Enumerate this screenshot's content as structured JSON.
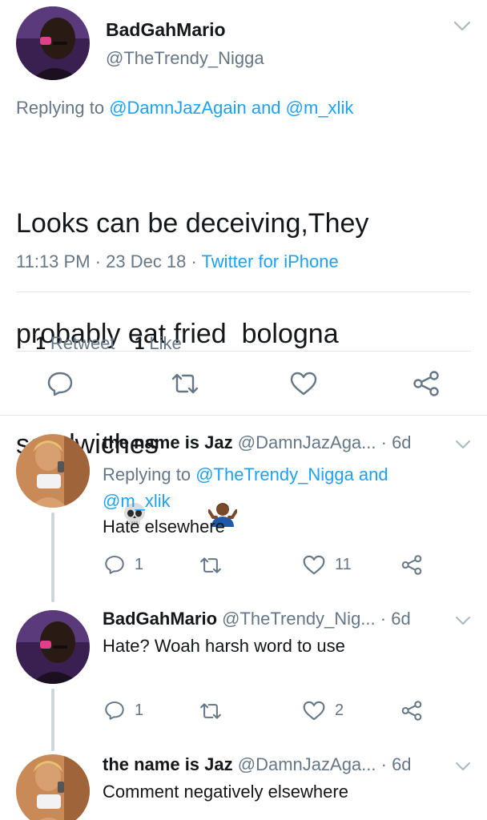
{
  "main_tweet": {
    "display_name": "BadGahMario",
    "handle": "@TheTrendy_Nigga",
    "replying_prefix": "Replying to ",
    "reply_user_1": "@DamnJazAgain",
    "reply_and": " and ",
    "reply_user_2": "@m_xlik",
    "text_line1": "Looks can be deceiving,They",
    "text_line2": "probably eat fried  bologna",
    "text_line3": "sandwiches",
    "time": "11:13 PM",
    "sep1": " · ",
    "date": "23 Dec 18",
    "sep2": " · ",
    "source": "Twitter for iPhone",
    "retweet_count": "1",
    "retweet_label": "Retweet",
    "like_count": "1",
    "like_label": "Like",
    "emojis": [
      "skull-icon",
      "man-shrugging-icon"
    ]
  },
  "replies": [
    {
      "display_name": "the name is Jaz",
      "handle": "@DamnJazAga...",
      "age": "· 6d",
      "replying_prefix": "Replying to ",
      "reply_user_1": "@TheTrendy_Nigga",
      "reply_and": " and",
      "reply_user_2": "@m_xlik",
      "text": "Hate elsewhere",
      "reply_count": "1",
      "retweet_count": "",
      "like_count": "11"
    },
    {
      "display_name": "BadGahMario",
      "handle": "@TheTrendy_Nig...",
      "age": "· 6d",
      "text": "Hate? Woah harsh word to use",
      "reply_count": "1",
      "retweet_count": "",
      "like_count": "2"
    },
    {
      "display_name": "the name is Jaz",
      "handle": "@DamnJazAga...",
      "age": "· 6d",
      "text": "Comment negatively elsewhere"
    }
  ],
  "colors": {
    "accent": "#1da1f2",
    "secondary_text": "#657786",
    "divider": "#e1e8ed",
    "thread_line": "#ccd6dd"
  }
}
